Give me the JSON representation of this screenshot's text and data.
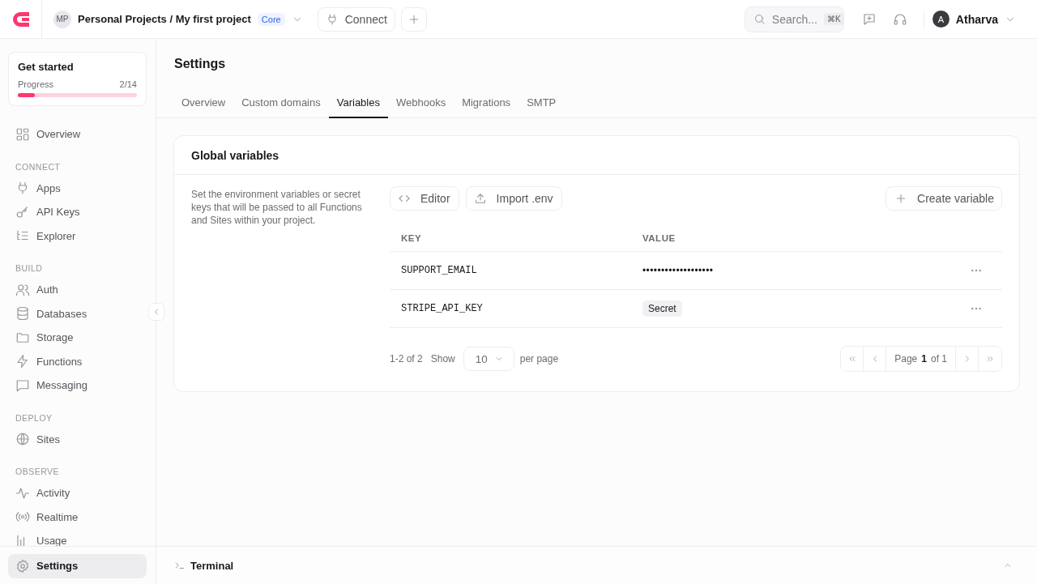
{
  "header": {
    "project_avatar": "MP",
    "project": "Personal Projects / My first project",
    "plan_badge": "Core",
    "connect_button": "Connect",
    "search": {
      "placeholder": "Search...",
      "shortcut": "⌘K"
    },
    "user": {
      "avatar": "A",
      "name": "Atharva"
    }
  },
  "sidebar": {
    "get_started": {
      "title": "Get started",
      "progress_label": "Progress",
      "progress_value": "2/14",
      "level": 0.143
    },
    "items": [
      {
        "label": "Overview",
        "selected": false
      }
    ],
    "sections": [
      {
        "heading": "CONNECT",
        "items": [
          {
            "label": "Apps",
            "selected": false
          },
          {
            "label": "API Keys",
            "selected": false
          },
          {
            "label": "Explorer",
            "selected": false
          }
        ]
      },
      {
        "heading": "BUILD",
        "items": [
          {
            "label": "Auth",
            "selected": false
          },
          {
            "label": "Databases",
            "selected": false
          },
          {
            "label": "Storage",
            "selected": false
          },
          {
            "label": "Functions",
            "selected": false
          },
          {
            "label": "Messaging",
            "selected": false
          }
        ]
      },
      {
        "heading": "DEPLOY",
        "items": [
          {
            "label": "Sites",
            "selected": false
          }
        ]
      },
      {
        "heading": "OBSERVE",
        "items": [
          {
            "label": "Activity",
            "selected": false
          },
          {
            "label": "Realtime",
            "selected": false
          },
          {
            "label": "Usage",
            "selected": false
          }
        ]
      }
    ],
    "footer_item": {
      "label": "Settings",
      "selected": true
    }
  },
  "page": {
    "title": "Settings",
    "tabs": [
      {
        "label": "Overview",
        "selected": false
      },
      {
        "label": "Custom domains",
        "selected": false
      },
      {
        "label": "Variables",
        "selected": true
      },
      {
        "label": "Webhooks",
        "selected": false
      },
      {
        "label": "Migrations",
        "selected": false
      },
      {
        "label": "SMTP",
        "selected": false
      }
    ]
  },
  "card": {
    "title": "Global variables",
    "description": "Set the environment variables or secret keys that will be passed to all Functions and Sites within your project.",
    "buttons": [
      "Editor",
      "Import .env"
    ],
    "create_button": "Create variable",
    "table": {
      "columns": [
        "KEY",
        "VALUE"
      ],
      "rows": [
        {
          "key": "SUPPORT_EMAIL",
          "kind": "masked",
          "value": "•••••••••••••••••••"
        },
        {
          "key": "STRIPE_API_KEY",
          "kind": "secret",
          "value": "Secret"
        }
      ]
    },
    "footer": {
      "range": "1-2 of 2",
      "show_label": "Show",
      "page_size": "10",
      "per_page_label": "per page",
      "page_label": "Page",
      "page_number": "1",
      "page_total": "of 1"
    }
  },
  "terminal": {
    "title": "Terminal"
  }
}
